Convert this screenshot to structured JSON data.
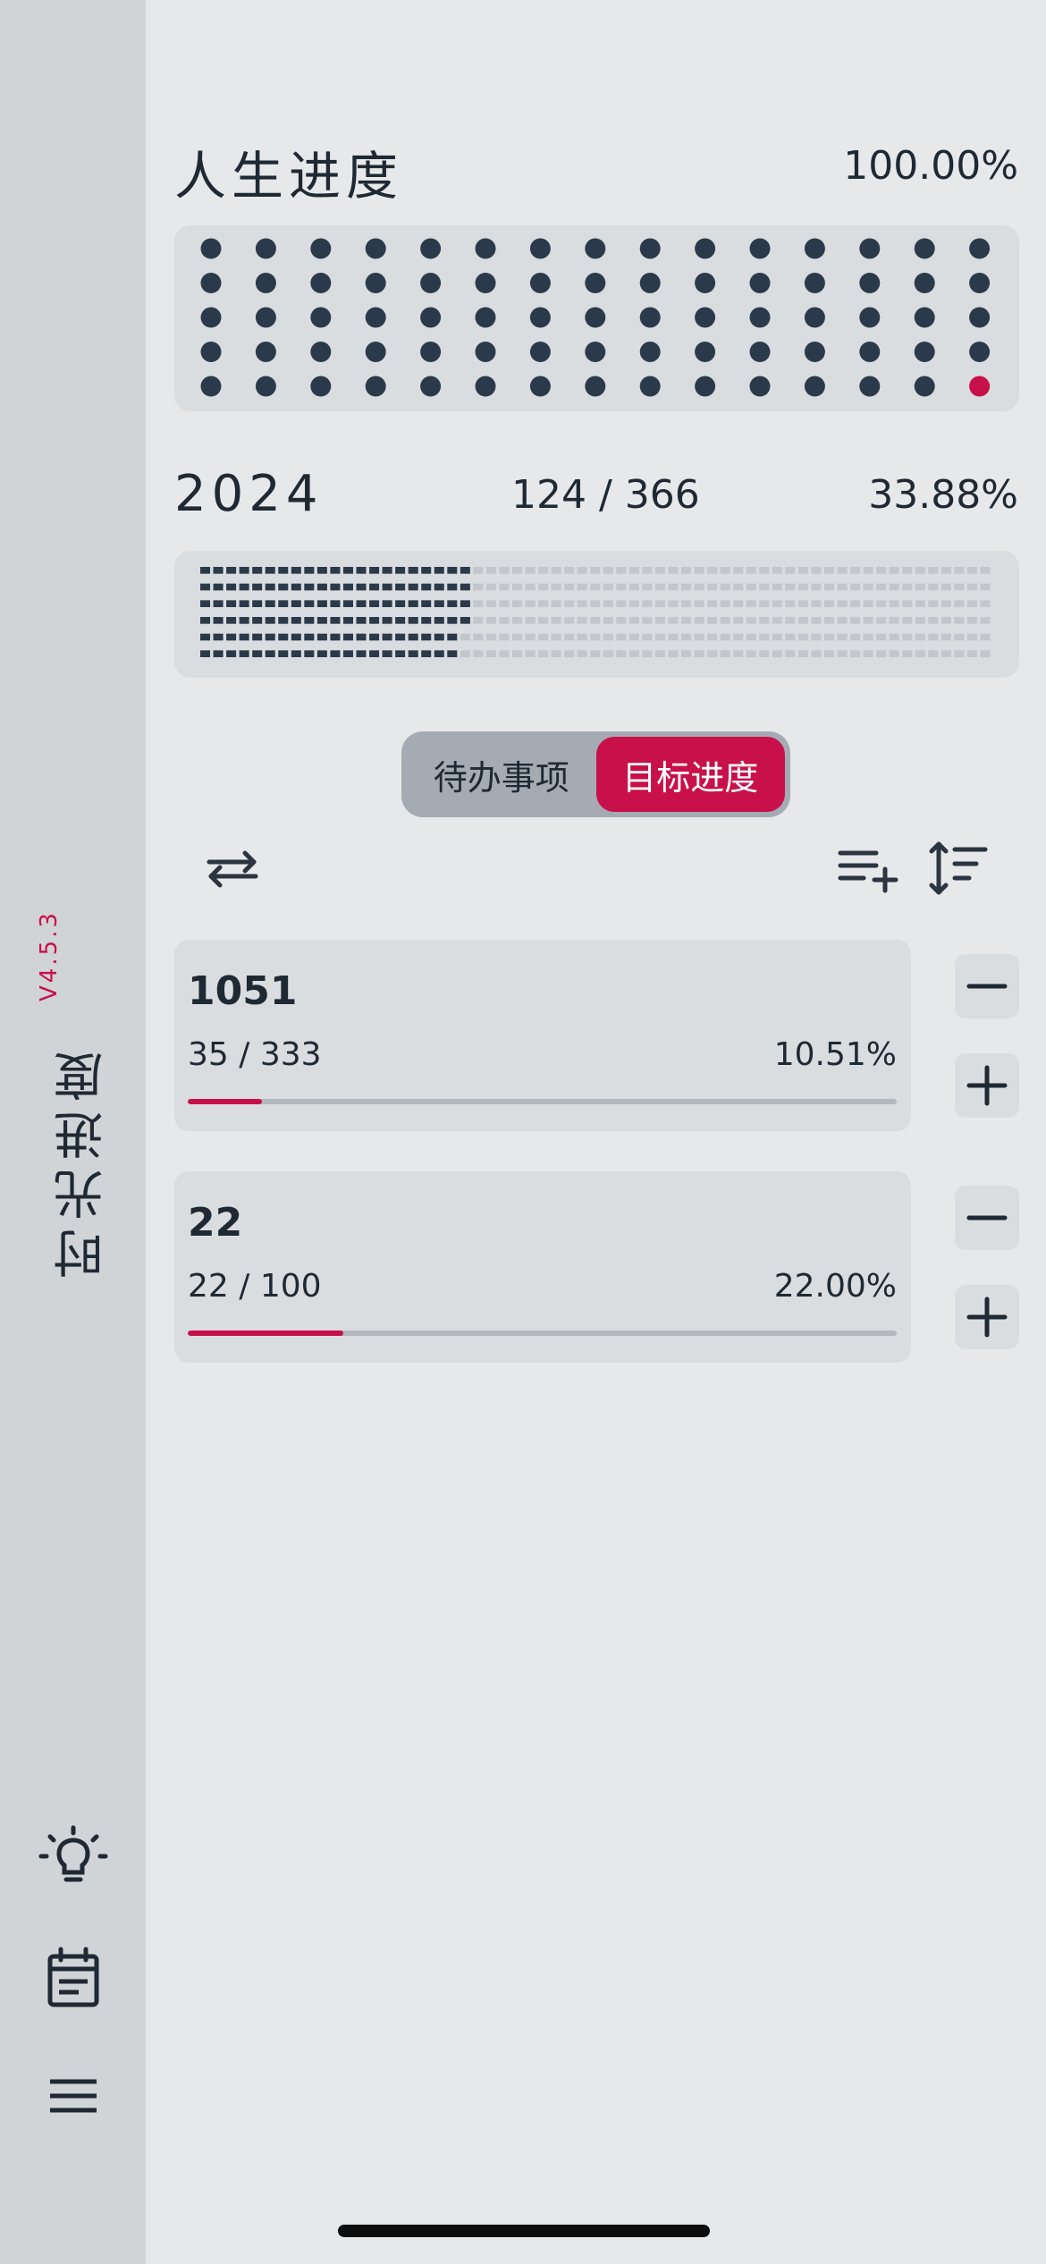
{
  "app": {
    "name": "时光进度",
    "version": "V4.5.3"
  },
  "life": {
    "title": "人生进度",
    "percent": "100.00%",
    "total_dots": 75,
    "filled_dots": 75
  },
  "year": {
    "title": "2024",
    "count": "124 / 366",
    "percent": "33.88%",
    "progress": 0.3388
  },
  "tabs": {
    "todo": "待办事项",
    "goals": "目标进度",
    "active": "goals"
  },
  "goals": [
    {
      "name": "1051",
      "count": "35 / 333",
      "percent": "10.51%",
      "progress": 0.1051
    },
    {
      "name": "22",
      "count": "22 / 100",
      "percent": "22.00%",
      "progress": 0.22
    }
  ],
  "icons": {
    "swap": "swap-arrows-icon",
    "add_list": "playlist-add-icon",
    "sort": "sort-icon",
    "minus": "minus-icon",
    "plus": "plus-icon",
    "bulb": "lightbulb-icon",
    "calendar": "calendar-icon",
    "menu": "menu-icon"
  },
  "colors": {
    "accent": "#c8104a",
    "dot": "#2b3a4a",
    "background": "#e6e8ea",
    "sidebar": "#d0d4d6"
  }
}
